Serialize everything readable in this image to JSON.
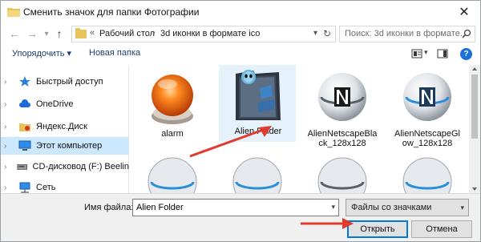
{
  "window": {
    "title": "Сменить значок для папки Фотографии",
    "close_glyph": "✕"
  },
  "nav": {
    "back_glyph": "←",
    "forward_glyph": "→",
    "up_glyph": "↑",
    "address": {
      "overflow_glyph": "«",
      "segments": [
        "Рабочий стол",
        "3d иконки в формате ico"
      ],
      "separator": "›"
    },
    "search_placeholder": "Поиск: 3d иконки в формате..."
  },
  "toolbar": {
    "organize_label": "Упорядочить ▾",
    "new_folder_label": "Новая папка",
    "help_glyph": "?"
  },
  "sidebar": {
    "items": [
      {
        "label": "Быстрый доступ",
        "icon": "star-icon",
        "selected": false
      },
      {
        "label": "OneDrive",
        "icon": "cloud-icon",
        "selected": false
      },
      {
        "label": "Яндекс.Диск",
        "icon": "yandex-disk-icon",
        "selected": false
      },
      {
        "label": "Этот компьютер",
        "icon": "computer-icon",
        "selected": true
      },
      {
        "label": "CD-дисковод (F:) Beelin",
        "icon": "cd-drive-icon",
        "selected": false
      },
      {
        "label": "Сеть",
        "icon": "network-icon",
        "selected": false
      }
    ]
  },
  "files": [
    {
      "label": "alarm",
      "icon": "alarm-icon",
      "selected": false
    },
    {
      "label": "Alien Folder",
      "icon": "alien-folder-icon",
      "selected": true
    },
    {
      "label": "AlienNetscapeBlack_128x128",
      "label_display": "AlienNetscapeBla ck_128x128",
      "icon": "netscape-icon",
      "selected": false
    },
    {
      "label": "AlienNetscapeGlow_128x128",
      "label_display": "AlienNetscapeGl ow_128x128",
      "icon": "netscape-icon",
      "selected": false
    }
  ],
  "bottom": {
    "filename_label": "Имя файла:",
    "filename_value": "Alien Folder",
    "filetype_value": "Файлы со значками",
    "open_label": "Открыть",
    "cancel_label": "Отмена"
  },
  "colors": {
    "accent": "#0078d7",
    "selection": "#cce8ff",
    "annotation_arrow": "#e03b2f"
  }
}
